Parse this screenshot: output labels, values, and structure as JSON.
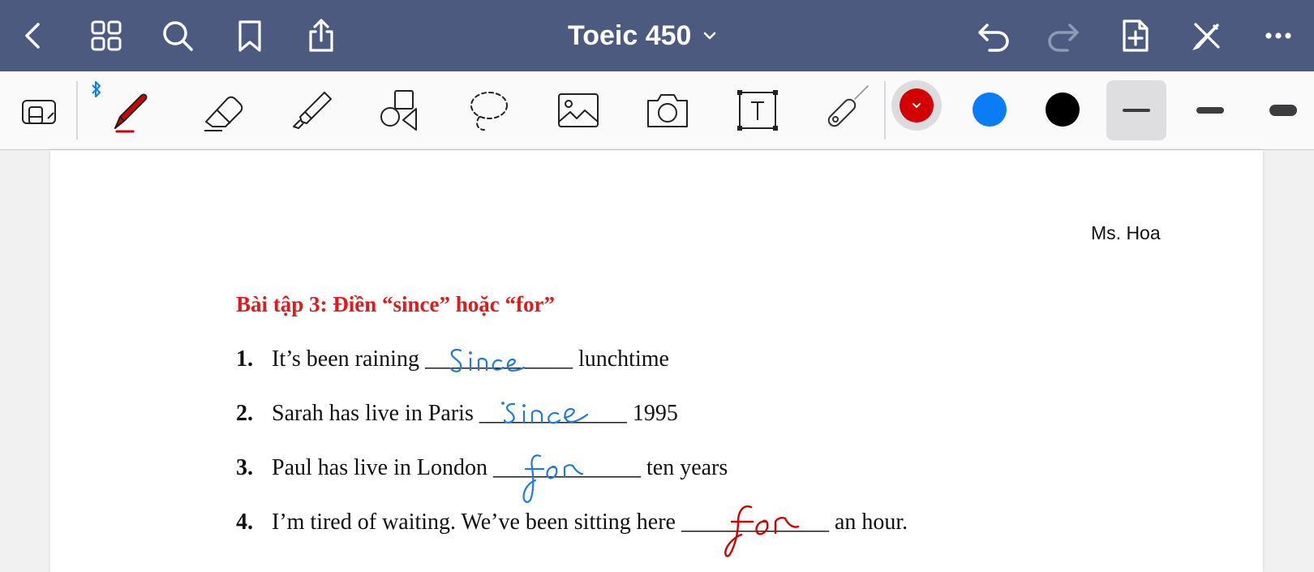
{
  "app": {
    "document_title": "Toeic 450"
  },
  "topbar": {
    "left_icons": [
      "back-icon",
      "grid-icon",
      "search-icon",
      "bookmark-icon",
      "share-icon"
    ],
    "right_icons": [
      "undo-icon",
      "redo-icon",
      "add-page-icon",
      "close-pen-icon",
      "more-icon"
    ]
  },
  "toolbar": {
    "tools": [
      "read-mode-icon",
      "pen-icon",
      "eraser-icon",
      "highlighter-icon",
      "shapes-icon",
      "lasso-icon",
      "image-icon",
      "camera-icon",
      "text-box-icon",
      "laser-pointer-icon"
    ],
    "selected_tool": "pen-icon",
    "colors": {
      "selected": "#d40000",
      "blue": "#0a7cf5",
      "black": "#000000"
    },
    "stroke_sizes": [
      "thin",
      "medium",
      "thick"
    ],
    "selected_stroke": "thin"
  },
  "document": {
    "author": "Ms. Hoa",
    "heading": "Bài tập 3: Điền “since” hoặc “for”",
    "questions": [
      {
        "num": "1.",
        "before": "It’s been raining ",
        "blank": "_____________",
        "after": " lunchtime",
        "answer": "Since",
        "ink_color": "#1f7ae0"
      },
      {
        "num": "2.",
        "before": "Sarah has live in Paris ",
        "blank": "_____________",
        "after": " 1995",
        "answer": "since",
        "ink_color": "#1f7ae0"
      },
      {
        "num": "3.",
        "before": "Paul has live in London ",
        "blank": "_____________",
        "after": " ten years",
        "answer": "for",
        "ink_color": "#1f7ae0"
      },
      {
        "num": "4.",
        "before": "I’m tired of waiting. We’ve been sitting here ",
        "blank": "_____________",
        "after": " an hour.",
        "answer": "for",
        "ink_color": "#d40000"
      }
    ]
  }
}
